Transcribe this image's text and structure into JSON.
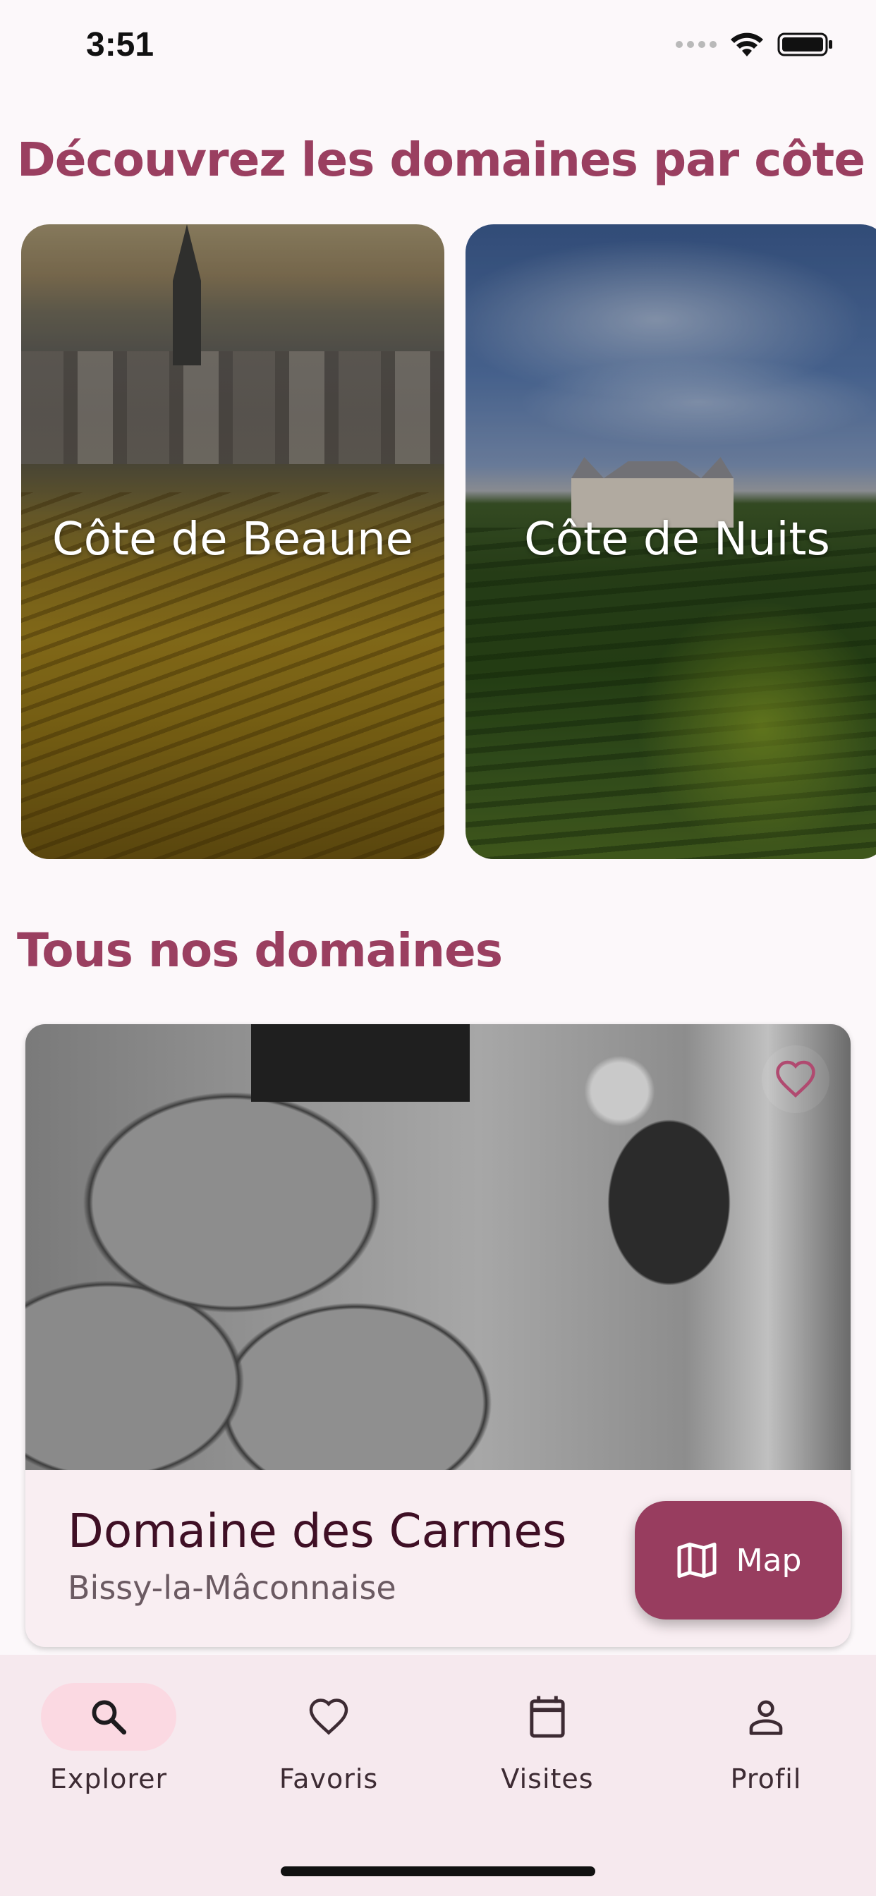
{
  "status_bar": {
    "time": "3:51"
  },
  "sections": {
    "cotes_title": "Découvrez les domaines par côte",
    "domains_title": "Tous nos domaines"
  },
  "cotes": [
    {
      "label": "Côte de Beaune"
    },
    {
      "label": "Côte de Nuits"
    }
  ],
  "domain": {
    "name": "Domaine des Carmes",
    "town": "Bissy-la-Mâconnaise",
    "favorite_icon": "heart-outline-icon"
  },
  "fab": {
    "label": "Map",
    "icon": "map-icon"
  },
  "nav": {
    "items": [
      {
        "label": "Explorer",
        "icon": "search-icon",
        "active": true
      },
      {
        "label": "Favoris",
        "icon": "heart-icon",
        "active": false
      },
      {
        "label": "Visites",
        "icon": "calendar-icon",
        "active": false
      },
      {
        "label": "Profil",
        "icon": "person-icon",
        "active": false
      }
    ]
  },
  "colors": {
    "accent": "#983d5f",
    "heading": "#9a3f60",
    "nav_background": "#f6e9ee",
    "active_pill": "#fbd9e2"
  }
}
